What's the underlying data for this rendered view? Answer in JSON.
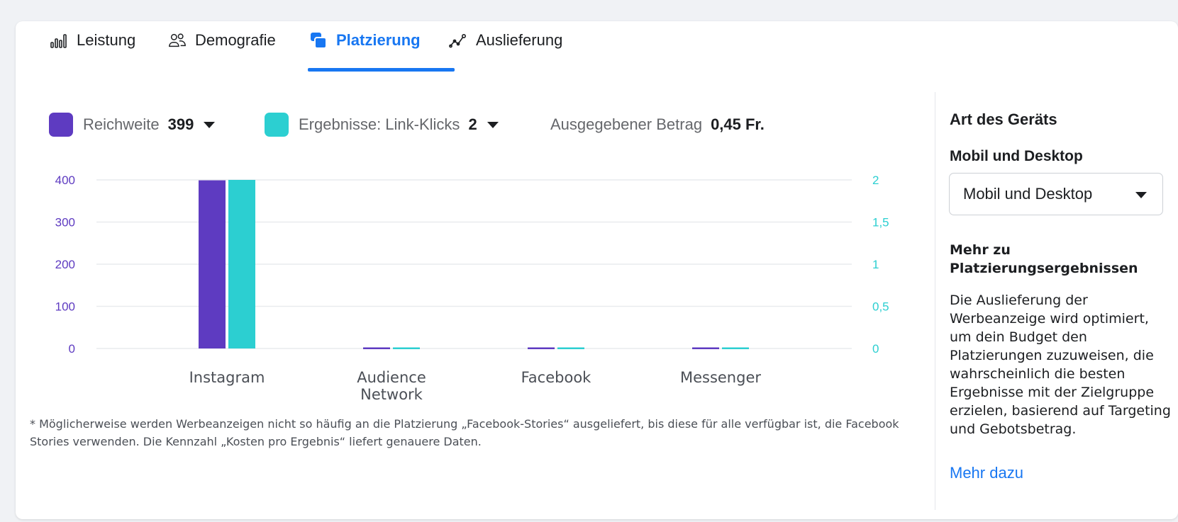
{
  "tabs": [
    {
      "label": "Leistung",
      "icon": "bar-chart-icon"
    },
    {
      "label": "Demografie",
      "icon": "people-icon"
    },
    {
      "label": "Platzierung",
      "icon": "placement-icon",
      "active": true
    },
    {
      "label": "Auslieferung",
      "icon": "delivery-trend-icon"
    }
  ],
  "metrics": {
    "reach": {
      "label": "Reichweite",
      "value": "399",
      "color": "#5e3bc1"
    },
    "results": {
      "label": "Ergebnisse: Link-Klicks",
      "value": "2",
      "color": "#2ccfd1"
    },
    "spent": {
      "label": "Ausgegebener Betrag",
      "value": "0,45 Fr."
    }
  },
  "chart_data": {
    "type": "bar",
    "categories": [
      "Instagram",
      "Audience Network",
      "Facebook",
      "Messenger"
    ],
    "series": [
      {
        "name": "Reichweite",
        "values": [
          399,
          0,
          0,
          0
        ],
        "axis": "left",
        "color": "#5e3bc1"
      },
      {
        "name": "Ergebnisse: Link-Klicks",
        "values": [
          2,
          0,
          0,
          0
        ],
        "axis": "right",
        "color": "#2ccfd1"
      }
    ],
    "ylim_left": [
      0,
      400
    ],
    "yticks_left": [
      "0",
      "100",
      "200",
      "300",
      "400"
    ],
    "ylim_right": [
      0,
      2
    ],
    "yticks_right": [
      "0",
      "0,5",
      "1",
      "1,5",
      "2"
    ],
    "grid": true
  },
  "footnote": "* Möglicherweise werden Werbeanzeigen nicht so häufig an die Platzierung „Facebook-Stories“ ausgeliefert, bis diese für alle verfügbar ist, die Facebook Stories verwenden. Die Kennzahl „Kosten pro Ergebnis“ liefert genauere Daten.",
  "side": {
    "title": "Art des Geräts",
    "subtitle": "Mobil und Desktop",
    "select_value": "Mobil und Desktop",
    "more_heading": "Mehr zu Platzierungsergebnissen",
    "body": "Die Auslieferung der Werbeanzeige wird optimiert, um dein Budget den Platzierungen zuzuweisen, die wahrscheinlich die besten Ergebnisse mit der Zielgruppe erzielen, basierend auf Targeting und Gebotsbetrag.",
    "link": "Mehr dazu"
  }
}
